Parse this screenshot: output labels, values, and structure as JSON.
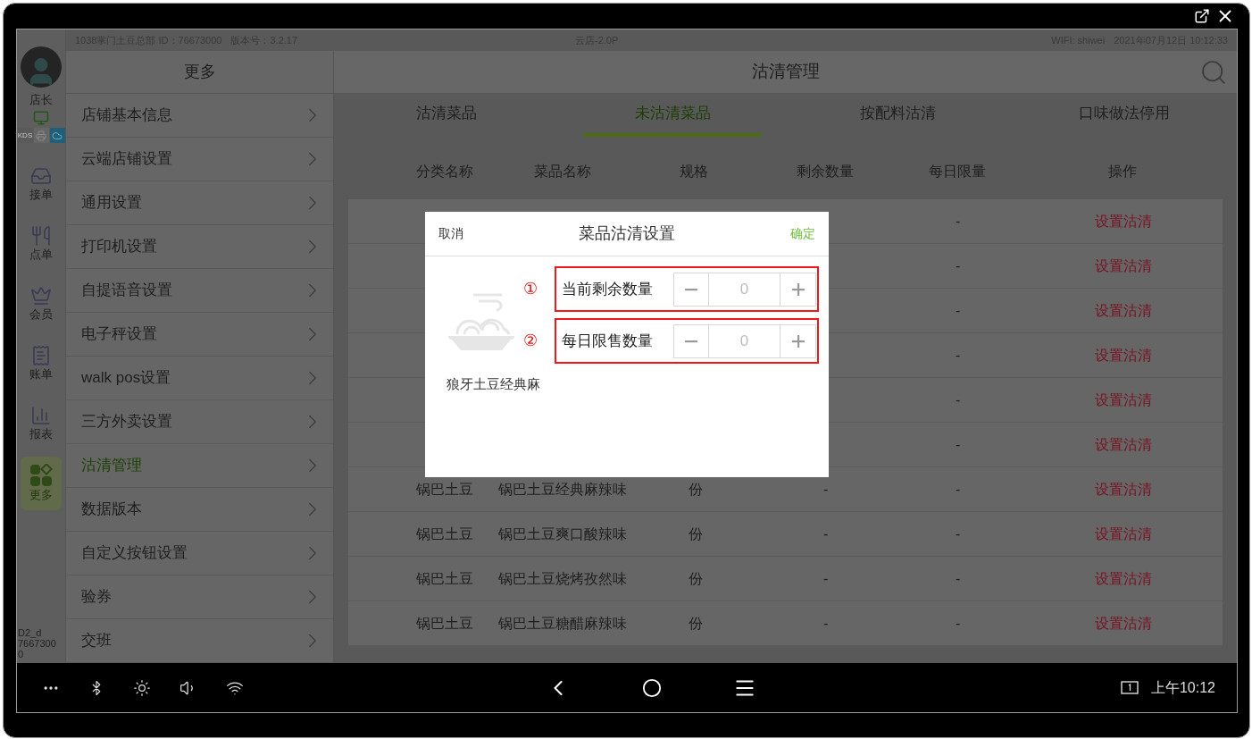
{
  "status_bar": {
    "store": "1038掌门土豆总部 ID：76673000",
    "version": "版本号：3.2.17",
    "app": "云店-2.0P",
    "wifi": "WIFI: shiwei",
    "datetime": "2021年07月12日 10:12:33"
  },
  "rail": {
    "user": "店长",
    "kds": "KDS",
    "items": [
      {
        "label": "接单",
        "selected": false
      },
      {
        "label": "点单",
        "selected": false
      },
      {
        "label": "会员",
        "selected": false
      },
      {
        "label": "账单",
        "selected": false
      },
      {
        "label": "报表",
        "selected": false
      },
      {
        "label": "更多",
        "selected": true
      }
    ],
    "device_lines": [
      "D2_d",
      "76673000"
    ]
  },
  "menu": {
    "title": "更多",
    "items": [
      {
        "label": "店铺基本信息",
        "selected": false
      },
      {
        "label": "云端店铺设置",
        "selected": false
      },
      {
        "label": "通用设置",
        "selected": false
      },
      {
        "label": "打印机设置",
        "selected": false
      },
      {
        "label": "自提语音设置",
        "selected": false
      },
      {
        "label": "电子秤设置",
        "selected": false
      },
      {
        "label": "walk pos设置",
        "selected": false
      },
      {
        "label": "三方外卖设置",
        "selected": false
      },
      {
        "label": "沽清管理",
        "selected": true
      },
      {
        "label": "数据版本",
        "selected": false
      },
      {
        "label": "自定义按钮设置",
        "selected": false
      },
      {
        "label": "验券",
        "selected": false
      },
      {
        "label": "交班",
        "selected": false
      }
    ]
  },
  "content": {
    "title": "沽清管理",
    "tabs": [
      {
        "label": "沽清菜品",
        "selected": false
      },
      {
        "label": "未沽清菜品",
        "selected": true
      },
      {
        "label": "按配料沽清",
        "selected": false
      },
      {
        "label": "口味做法停用",
        "selected": false
      }
    ],
    "columns": [
      "分类名称",
      "菜品名称",
      "规格",
      "剩余数量",
      "每日限量",
      "操作"
    ],
    "rows": [
      {
        "daily": "-",
        "action": "设置沽清"
      },
      {
        "daily": "-",
        "action": "设置沽清"
      },
      {
        "daily": "-",
        "action": "设置沽清"
      },
      {
        "daily": "-",
        "action": "设置沽清"
      },
      {
        "daily": "-",
        "action": "设置沽清"
      },
      {
        "daily": "-",
        "action": "设置沽清"
      },
      {
        "category": "锅巴土豆",
        "dish": "锅巴土豆经典麻辣味",
        "spec": "份",
        "remaining": "-",
        "daily": "-",
        "action": "设置沽清"
      },
      {
        "category": "锅巴土豆",
        "dish": "锅巴土豆爽口酸辣味",
        "spec": "份",
        "remaining": "-",
        "daily": "-",
        "action": "设置沽清"
      },
      {
        "category": "锅巴土豆",
        "dish": "锅巴土豆烧烤孜然味",
        "spec": "份",
        "remaining": "-",
        "daily": "-",
        "action": "设置沽清"
      },
      {
        "category": "锅巴土豆",
        "dish": "锅巴土豆糖醋麻辣味",
        "spec": "份",
        "remaining": "-",
        "daily": "-",
        "action": "设置沽清"
      }
    ]
  },
  "dialog": {
    "cancel": "取消",
    "title": "菜品沽清设置",
    "confirm": "确定",
    "dish": "狼牙土豆经典麻",
    "fields": [
      {
        "marker": "①",
        "label": "当前剩余数量",
        "value": "0",
        "highlighted": true
      },
      {
        "marker": "②",
        "label": "每日限售数量",
        "value": "0",
        "highlighted": true
      }
    ]
  },
  "nav_bar": {
    "time": "上午10:12"
  }
}
